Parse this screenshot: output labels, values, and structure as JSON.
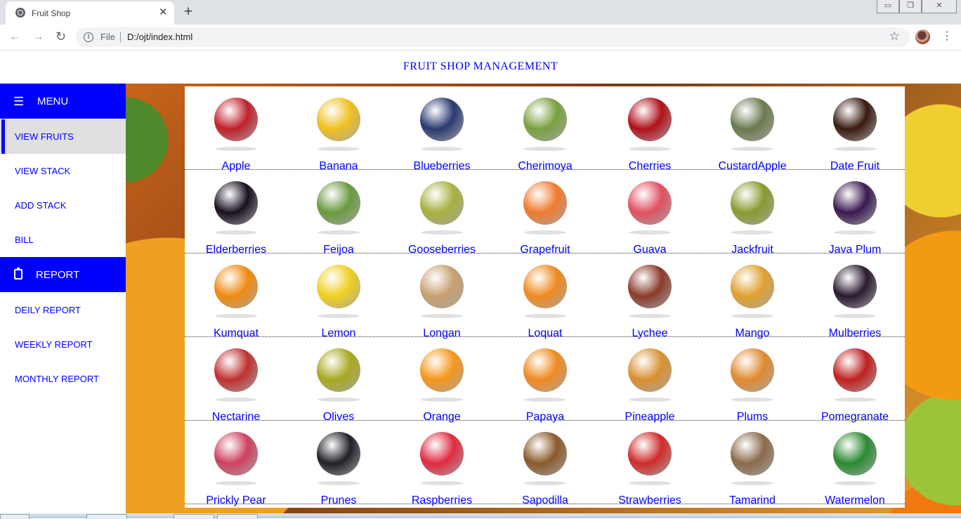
{
  "browser": {
    "tab_title": "Fruit Shop",
    "tab_close": "✕",
    "new_tab": "+",
    "scheme": "File",
    "url": "D:/ojt/index.html"
  },
  "page": {
    "title": "FRUIT SHOP MANAGEMENT"
  },
  "sidebar": {
    "menu_label": "MENU",
    "menu_items": [
      "VIEW FRUITS",
      "VIEW STACK",
      "ADD STACK",
      "BILL"
    ],
    "report_label": "REPORT",
    "report_items": [
      "DEILY REPORT",
      "WEEKLY REPORT",
      "MONTHLY REPORT"
    ]
  },
  "fruits": [
    [
      "Apple",
      "Banana",
      "Blueberries",
      "Cherimoya",
      "Cherries",
      "CustardApple",
      "Date Fruit"
    ],
    [
      "Elderberries",
      "Feijoa",
      "Gooseberries",
      "Grapefruit",
      "Guava",
      "Jackfruit",
      "Java Plum"
    ],
    [
      "Kumquat",
      "Lemon",
      "Longan",
      "Loquat",
      "Lychee",
      "Mango",
      "Mulberries"
    ],
    [
      "Nectarine",
      "Olives",
      "Orange",
      "Papaya",
      "Pineapple",
      "Plums",
      "Pomegranate"
    ],
    [
      "Prickly Pear",
      "Prunes",
      "Raspberries",
      "Sapodilla",
      "Strawberries",
      "Tamarind",
      "Watermelon"
    ]
  ],
  "colors": {
    "accent": "#0000ff",
    "active_item_bg": "#e0e0e0"
  }
}
